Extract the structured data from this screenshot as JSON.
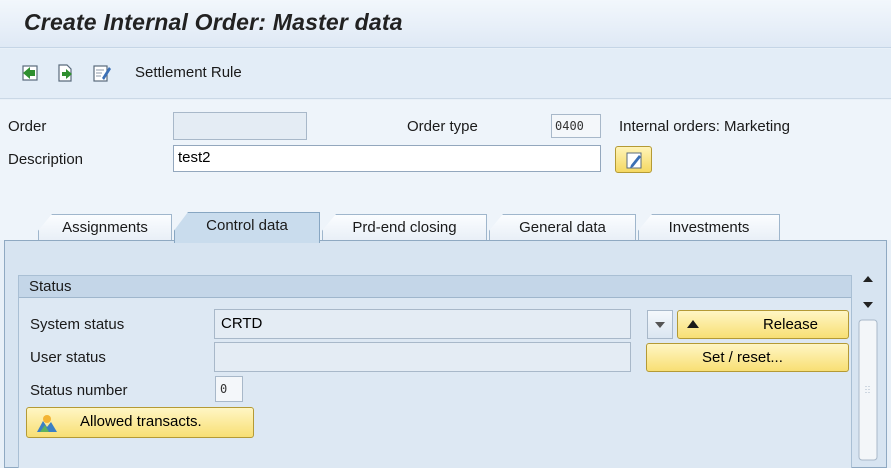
{
  "window": {
    "title": "Create Internal Order: Master data"
  },
  "toolbar": {
    "icons": [
      "back-icon",
      "forward-icon",
      "edit-icon"
    ],
    "settlement_rule_label": "Settlement Rule"
  },
  "header": {
    "order_label": "Order",
    "order_value": "",
    "order_type_label": "Order type",
    "order_type_value": "0400",
    "order_type_desc": "Internal orders: Marketing",
    "description_label": "Description",
    "description_value": "test2"
  },
  "tabs": [
    {
      "label": "Assignments",
      "active": false
    },
    {
      "label": "Control data",
      "active": true
    },
    {
      "label": "Prd-end closing",
      "active": false
    },
    {
      "label": "General data",
      "active": false
    },
    {
      "label": "Investments",
      "active": false
    }
  ],
  "status_group": {
    "title": "Status",
    "system_status_label": "System status",
    "system_status_value": "CRTD",
    "user_status_label": "User status",
    "user_status_value": "",
    "status_number_label": "Status number",
    "status_number_value": "0",
    "release_label": "Release",
    "set_reset_label": "Set / reset...",
    "allowed_transacts_label": "Allowed transacts."
  },
  "colors": {
    "accent_yellow": "#f8df74",
    "header_bg": "#e3edf7",
    "tab_active": "#c9dced"
  }
}
